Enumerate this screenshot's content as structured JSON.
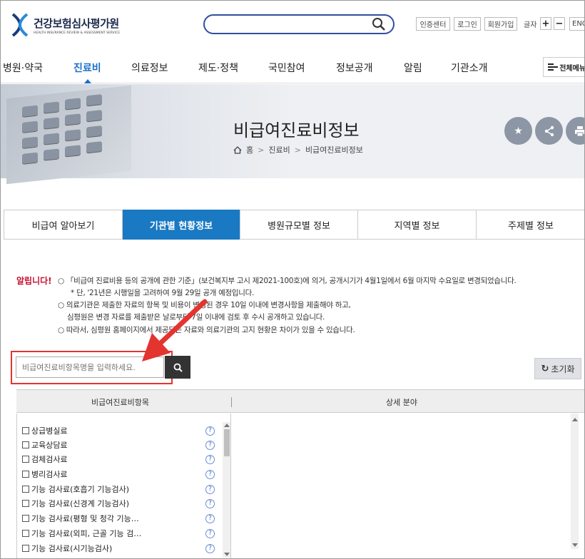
{
  "header": {
    "logo_title": "건강보험심사평가원",
    "logo_subtitle": "HEALTH INSURANCE REVIEW & ASSESSMENT SERVICE",
    "search_placeholder": "",
    "util_links": [
      "인증센터",
      "로그인",
      "회원가입"
    ],
    "font_size_label": "글자",
    "font_plus": "+",
    "font_minus": "−",
    "lang": "ENG"
  },
  "gnb": {
    "items": [
      "병원·약국",
      "진료비",
      "의료정보",
      "제도·정책",
      "국민참여",
      "정보공개",
      "알림",
      "기관소개"
    ],
    "active_index": 1,
    "all_menu": "전체메뉴"
  },
  "banner": {
    "title": "비급여진료비정보",
    "breadcrumb": [
      "홈",
      "진료비",
      "비급여진료비정보"
    ],
    "icons": [
      "star-icon",
      "share-icon",
      "print-icon"
    ]
  },
  "tabs": {
    "items": [
      "비급여 알아보기",
      "기관별 현황정보",
      "병원규모별 정보",
      "지역별 정보",
      "주제별 정보"
    ],
    "active_index": 1
  },
  "notice": {
    "label": "알립니다!",
    "lines": [
      "○ 「비급여 진료비용 등의 공개에 관한 기준」(보건복지부 고시 제2021-100호)에 의거, 공개시기가 4월1일에서 6월 마지막 수요일로 변경되었습니다.",
      "* 단, '21년은 시행일을 고려하여 9월 29일 공개 예정입니다.",
      "○ 의료기관은 제출한 자료의 항목 및 비용이 변경된 경우 10일 이내에 변경사항을 제출해야 하고,",
      "심평원은 변경 자료를 제출받은 날로부터 7일 이내에 검토 후 수시 공개하고 있습니다.",
      "○ 따라서, 심평원 홈페이지에서 제공되는 자료와 의료기관의 고지 현황은 차이가 있을 수 있습니다."
    ]
  },
  "search": {
    "placeholder": "비급여진료비항목명을 입력하세요.",
    "reset_label": "초기화"
  },
  "table": {
    "col1": "비급여진료비항목",
    "col2": "상세 분야",
    "items": [
      "상급병실료",
      "교육상담료",
      "검체검사료",
      "병리검사료",
      "기능 검사료(호흡기 기능검사)",
      "기능 검사료(신경계 기능검사)",
      "기능 검사료(평형 및 청각 기능…",
      "기능 검사료(외피, 근골 기능 검…",
      "기능 검사료(시기능검사)"
    ],
    "help_glyph": "?"
  },
  "colors": {
    "brand_blue": "#1979c3",
    "active_nav": "#1a6fc9",
    "highlight_red": "#e3342f",
    "notice_red": "#c8102e"
  }
}
